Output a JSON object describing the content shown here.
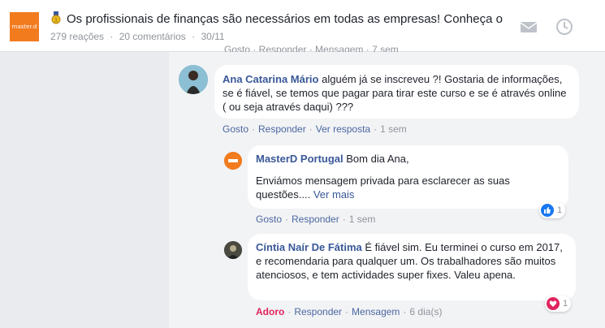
{
  "post": {
    "logo_text": "master.d",
    "title": "Os profissionais de finanças são necessários em todas as empresas! Conheça o",
    "reactions": "279 reações",
    "comments": "20 comentários",
    "date": "30/11"
  },
  "ghost_actions": "Gosto · Responder · Mensagem · 7 sem",
  "comments": [
    {
      "author": "Ana Catarina Mário",
      "text": "alguém já se inscreveu ?! Gostaria de informações, se é fiável, se temos que pagar para tirar este curso e se é através online ( ou seja através daqui) ???",
      "actions": [
        "Gosto",
        "Responder",
        "Ver resposta"
      ],
      "time": "1 sem"
    },
    {
      "author": "MasterD Portugal",
      "text_line1": "Bom dia Ana,",
      "text_body": "Enviámos mensagem privada para esclarecer as suas questões....",
      "see_more": "Ver mais",
      "actions": [
        "Gosto",
        "Responder"
      ],
      "time": "1 sem",
      "reaction_count": "1"
    },
    {
      "author": "Cíntia Naír De Fátima",
      "text": "É fiável sim. Eu terminei o curso em 2017, e recomendaria para qualquer um. Os trabalhadores são muitos atenciosos, e tem actividades super fixes. Valeu apena.",
      "actions": [
        "Adoro",
        "Responder",
        "Mensagem"
      ],
      "time": "6 dia(s)",
      "reaction_count": "1"
    }
  ],
  "colors": {
    "brand": "#f27b1e",
    "link": "#385898",
    "love": "#e0245e",
    "like": "#1877f2"
  },
  "icons": [
    "medal-icon",
    "envelope-icon",
    "clock-icon",
    "like-icon",
    "heart-icon"
  ]
}
